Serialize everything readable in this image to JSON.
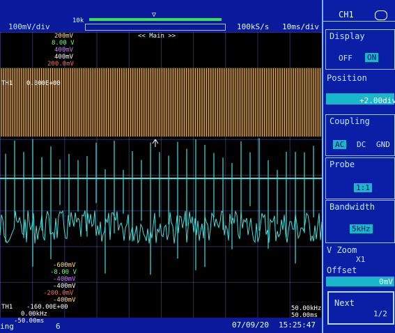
{
  "top": {
    "ch1_scale": "100mV/div",
    "mem_label": "10k",
    "trigger_marker": "▽",
    "sample_rate": "100kS/s",
    "time_div": "10ms/div"
  },
  "grid": {
    "zoom_label": "<< Main >>",
    "ch_scales": [
      "200mV",
      "8.00 V",
      "400mV",
      "400mV",
      "200.0mV"
    ],
    "ch_scale_colors": [
      "#ffe07a",
      "#6aff6a",
      "#d07cff",
      "#ffffff",
      "#ff6a4a"
    ],
    "th_label": "TH1",
    "th_value": "0.000E+00",
    "ch_offsets": [
      "-600mV",
      "-8.00 V",
      "-400mV",
      "-400mV",
      "-200.0mV",
      "-400mV"
    ],
    "ch_offset_colors": [
      "#ffe07a",
      "#6aff6a",
      "#d07cff",
      "#ffffff",
      "#ff6a4a",
      "#ffe07a"
    ],
    "th_bottom_label": "TH1",
    "th_bottom_value": "-160.00E+00",
    "freq_left": "0.00kHz",
    "time_left": "-50.00ms",
    "freq_right": "50.00kHz",
    "time_right": "50.00ms",
    "trace_colors": {
      "ch1": "#ffb877",
      "ch2": "#3fe0e0"
    }
  },
  "bottom": {
    "left_text": "ing",
    "six": "6",
    "date": "07/09/20",
    "time": "15:25:47"
  },
  "panel": {
    "channel": "CH1",
    "display_title": "Display",
    "display_off": "OFF",
    "display_on": "ON",
    "position_title": "Position",
    "position_value": "+2.00div",
    "coupling_title": "Coupling",
    "coupling_ac": "AC",
    "coupling_dc": "DC",
    "coupling_gnd": "GND",
    "probe_title": "Probe",
    "probe_value": "1:1",
    "bandwidth_title": "Bandwidth",
    "bandwidth_value": "5kHz",
    "vzoom_title": "V Zoom",
    "vzoom_value": "X1",
    "offset_title": "Offset",
    "offset_value": "0mV",
    "next_label": "Next",
    "next_page": "1/2"
  }
}
